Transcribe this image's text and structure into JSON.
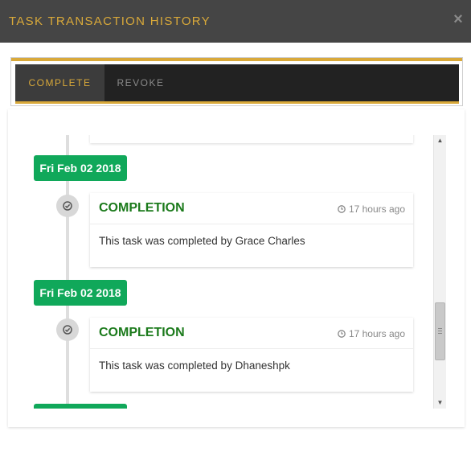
{
  "header": {
    "title": "TASK TRANSACTION HISTORY",
    "close_symbol": "×"
  },
  "tabs": [
    {
      "label": "COMPLETE",
      "active": true
    },
    {
      "label": "REVOKE",
      "active": false
    }
  ],
  "timeline": {
    "entries": [
      {
        "date": "Fri Feb 02 2018",
        "icon": "check-circle-icon",
        "title": "COMPLETION",
        "time": "17 hours ago",
        "body": "This task was completed by Grace Charles"
      },
      {
        "date": "Fri Feb 02 2018",
        "icon": "check-circle-icon",
        "title": "COMPLETION",
        "time": "17 hours ago",
        "body": "This task was completed by Dhaneshpk"
      }
    ]
  },
  "scrollbar": {
    "up_symbol": "▲",
    "down_symbol": "▼"
  },
  "colors": {
    "header_bg": "#454545",
    "accent_gold": "#d9a93a",
    "tab_bar_bg": "#222222",
    "date_badge_green": "#10a85a",
    "completion_green": "#1b7a1b"
  }
}
